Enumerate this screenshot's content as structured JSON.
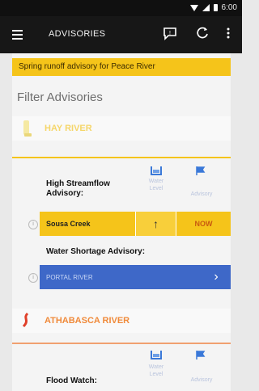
{
  "status_bar": {
    "time": "6:00"
  },
  "app_bar": {
    "title": "ADVISORIES",
    "icons": [
      "menu-icon",
      "feedback-icon",
      "refresh-icon",
      "more-vert-icon"
    ]
  },
  "banner": {
    "text": "Spring runoff advisory for Peace River"
  },
  "filter_label": "Filter Advisories",
  "rivers": [
    {
      "name": "HAY RIVER",
      "accent": "#f5c41a",
      "column_labels": [
        "Water Level",
        "Advisory"
      ],
      "advisories": [
        {
          "title": "High Streamflow Advisory:",
          "station": "Sousa Creek",
          "arrow": "↑",
          "status": "NOW"
        },
        {
          "title": "Water Shortage Advisory:",
          "station": "PORTAL RIVER",
          "arrow": "›"
        }
      ]
    },
    {
      "name": "ATHABASCA RIVER",
      "accent": "#f08a3a",
      "column_labels": [
        "Water Level",
        "Advisory"
      ],
      "advisories": [
        {
          "title": "Flood Watch:"
        }
      ]
    }
  ],
  "colors": {
    "yellow": "#f5c41a",
    "blue": "#3e68c8",
    "orange": "#f08a3a",
    "icon_blue": "#3a78d8"
  }
}
